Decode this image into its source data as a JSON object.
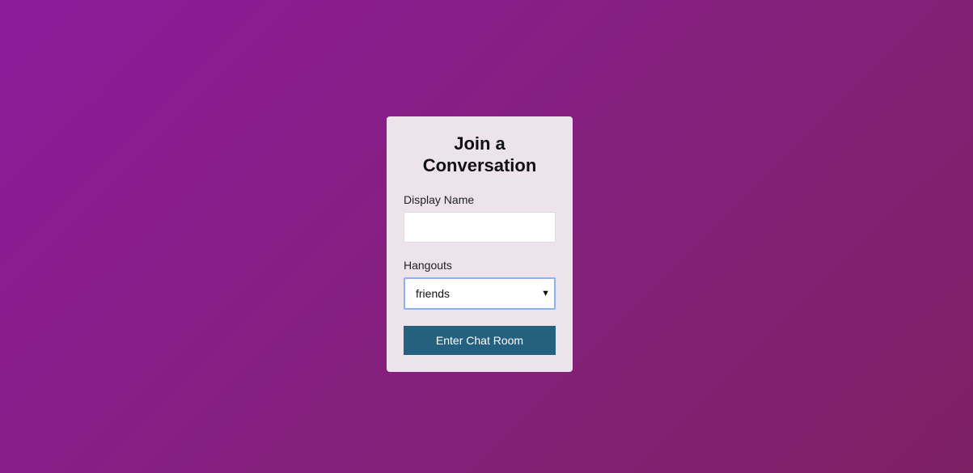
{
  "form": {
    "title_line1": "Join a",
    "title_line2": "Conversation",
    "display_name": {
      "label": "Display Name",
      "value": "",
      "placeholder": ""
    },
    "hangouts": {
      "label": "Hangouts",
      "selected": "friends"
    },
    "submit_label": "Enter Chat Room"
  },
  "colors": {
    "background_start": "#8c1b9b",
    "background_end": "#7e2064",
    "card": "#ece3eb",
    "button": "#25607f",
    "select_focus_border": "#8fb0ee"
  },
  "icons": {
    "select_caret": "caret-down-icon"
  }
}
